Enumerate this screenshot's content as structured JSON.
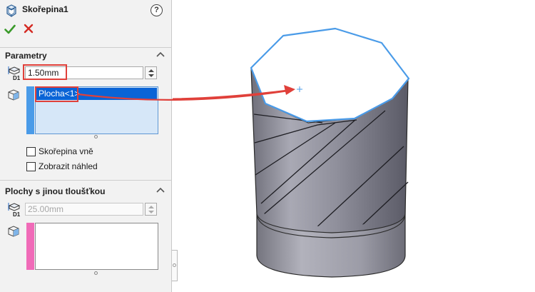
{
  "feature": {
    "title": "Skořepina1",
    "help_label": "?"
  },
  "parameters": {
    "section_title": "Parametry",
    "thickness_value": "1.50mm",
    "selected_faces": [
      "Plocha<1>"
    ],
    "checkbox_shell_outward": {
      "label": "Skořepina vně",
      "checked": false
    },
    "checkbox_show_preview": {
      "label": "Zobrazit náhled",
      "checked": false
    }
  },
  "multi_thickness": {
    "section_title": "Plochy s jinou tloušťkou",
    "thickness_value": "25.00mm",
    "selected_faces": []
  },
  "colors": {
    "panel_bg": "#f2f2f2",
    "selection_blue": "#0a64d6",
    "list_active_bg": "#d6e7f8",
    "face_strip_blue": "#4a9be8",
    "face_strip_pink": "#f06bb8",
    "highlight_edge": "#4a9be8",
    "annotation_red": "#e0403a",
    "model_gray": "#9a9aa6"
  },
  "icons": {
    "feature": "shell-feature-icon",
    "help": "help-icon",
    "ok": "checkmark-icon",
    "cancel": "close-icon",
    "collapse": "chevron-up-icon",
    "thickness": "thickness-dimension-icon",
    "faces": "face-selection-icon"
  }
}
